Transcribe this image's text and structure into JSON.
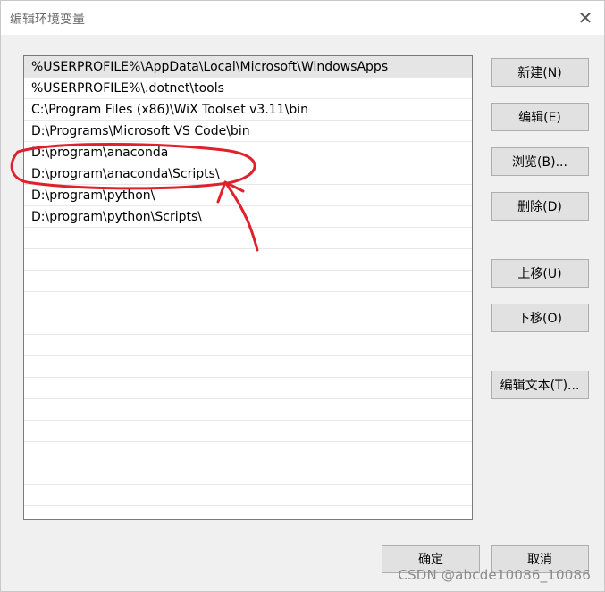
{
  "window": {
    "title": "编辑环境变量",
    "close_glyph": "✕"
  },
  "list": {
    "items": [
      "%USERPROFILE%\\AppData\\Local\\Microsoft\\WindowsApps",
      "%USERPROFILE%\\.dotnet\\tools",
      "C:\\Program Files (x86)\\WiX Toolset v3.11\\bin",
      "D:\\Programs\\Microsoft VS Code\\bin",
      "D:\\program\\anaconda",
      "D:\\program\\anaconda\\Scripts\\",
      "D:\\program\\python\\",
      "D:\\program\\python\\Scripts\\"
    ],
    "selected_index": 0
  },
  "buttons": {
    "new": "新建(N)",
    "edit": "编辑(E)",
    "browse": "浏览(B)...",
    "delete": "删除(D)",
    "move_up": "上移(U)",
    "move_down": "下移(O)",
    "edit_text": "编辑文本(T)...",
    "ok": "确定",
    "cancel": "取消"
  },
  "watermark": "CSDN @abcde10086_10086",
  "colors": {
    "annotation": "#e0202a"
  }
}
